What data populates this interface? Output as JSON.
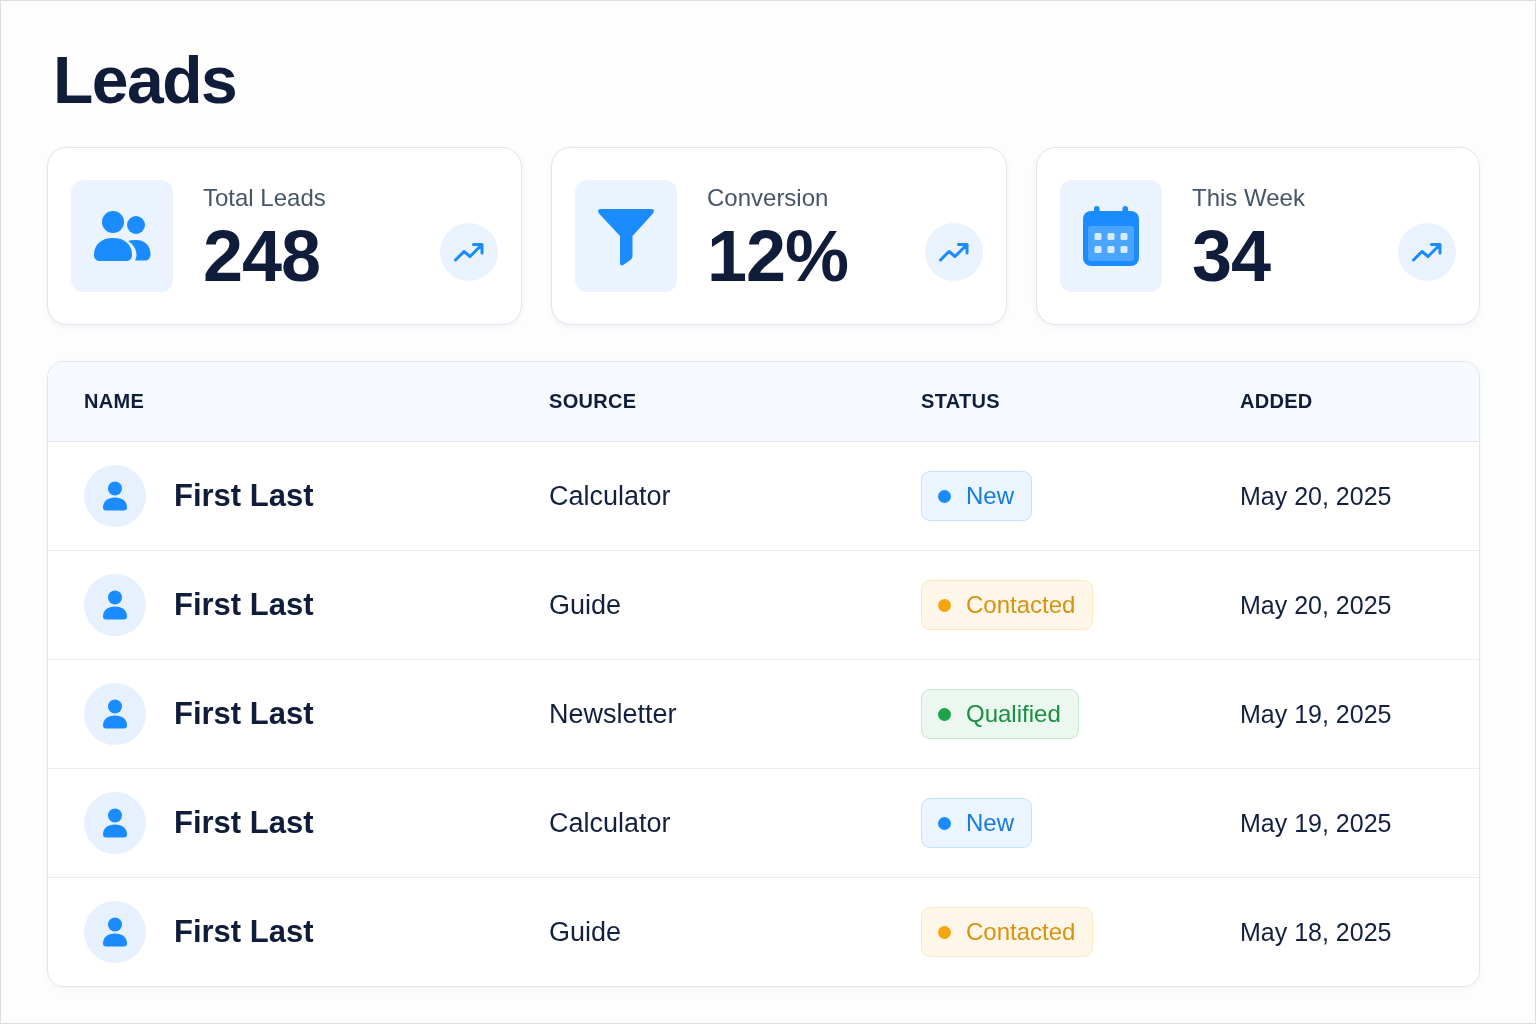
{
  "page": {
    "title": "Leads"
  },
  "stats": [
    {
      "label": "Total Leads",
      "value": "248"
    },
    {
      "label": "Conversion",
      "value": "12%"
    },
    {
      "label": "This Week",
      "value": "34"
    }
  ],
  "table": {
    "columns": [
      "NAME",
      "SOURCE",
      "STATUS",
      "ADDED"
    ],
    "rows": [
      {
        "name": "First Last",
        "source": "Calculator",
        "status": {
          "label": "New",
          "color": "#1a8cff"
        },
        "added": "May 20, 2025"
      },
      {
        "name": "First Last",
        "source": "Guide",
        "status": {
          "label": "Contacted",
          "color": "#f5a60f"
        },
        "added": "May 20, 2025"
      },
      {
        "name": "First Last",
        "source": "Newsletter",
        "status": {
          "label": "Qualified",
          "color": "#1ca44a"
        },
        "added": "May 19, 2025"
      },
      {
        "name": "First Last",
        "source": "Calculator",
        "status": {
          "label": "New",
          "color": "#1a8cff"
        },
        "added": "May 19, 2025"
      },
      {
        "name": "First Last",
        "source": "Guide",
        "status": {
          "label": "Contacted",
          "color": "#f5a60f"
        },
        "added": "May 18, 2025"
      }
    ]
  }
}
